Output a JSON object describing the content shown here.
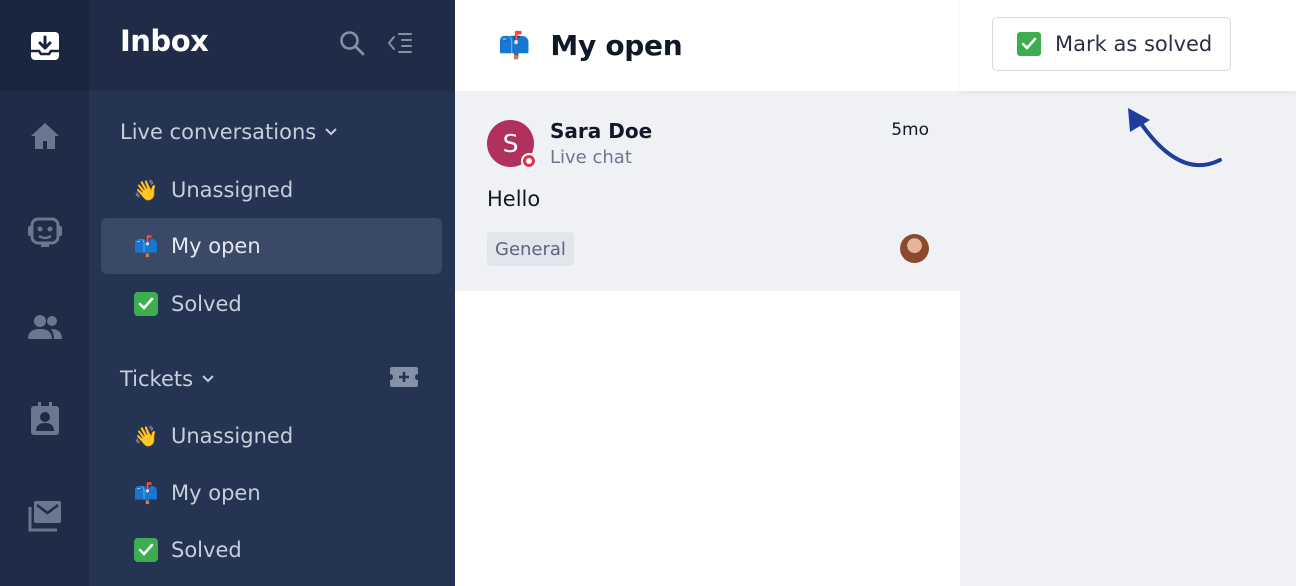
{
  "sidebar": {
    "title": "Inbox",
    "live_section": "Live conversations",
    "live_items": [
      {
        "emoji": "👋",
        "label": "Unassigned"
      },
      {
        "emoji": "📫",
        "label": "My open"
      },
      {
        "emoji": "✅",
        "label": "Solved"
      }
    ],
    "tickets_section": "Tickets",
    "ticket_items": [
      {
        "emoji": "👋",
        "label": "Unassigned"
      },
      {
        "emoji": "📫",
        "label": "My open"
      },
      {
        "emoji": "✅",
        "label": "Solved"
      }
    ]
  },
  "list": {
    "emoji": "📫",
    "title": "My open",
    "conversations": [
      {
        "avatar_initial": "S",
        "name": "Sara Doe",
        "channel": "Live chat",
        "time": "5mo",
        "message": "Hello",
        "tag": "General"
      }
    ]
  },
  "pane": {
    "mark_solved_label": "Mark as solved"
  },
  "colors": {
    "rail": "#1f2b47",
    "sidebar": "#263453",
    "active_item": "#3a4966",
    "avatar": "#b0315c",
    "success": "#3dae4f",
    "annotation_arrow": "#1f3d9c"
  },
  "icons": {
    "rail": [
      "inbox-icon",
      "home-icon",
      "bot-icon",
      "people-icon",
      "contact-icon",
      "mail-stack-icon"
    ],
    "header": [
      "search-icon",
      "collapse-sidebar-icon",
      "add-ticket-icon"
    ]
  }
}
